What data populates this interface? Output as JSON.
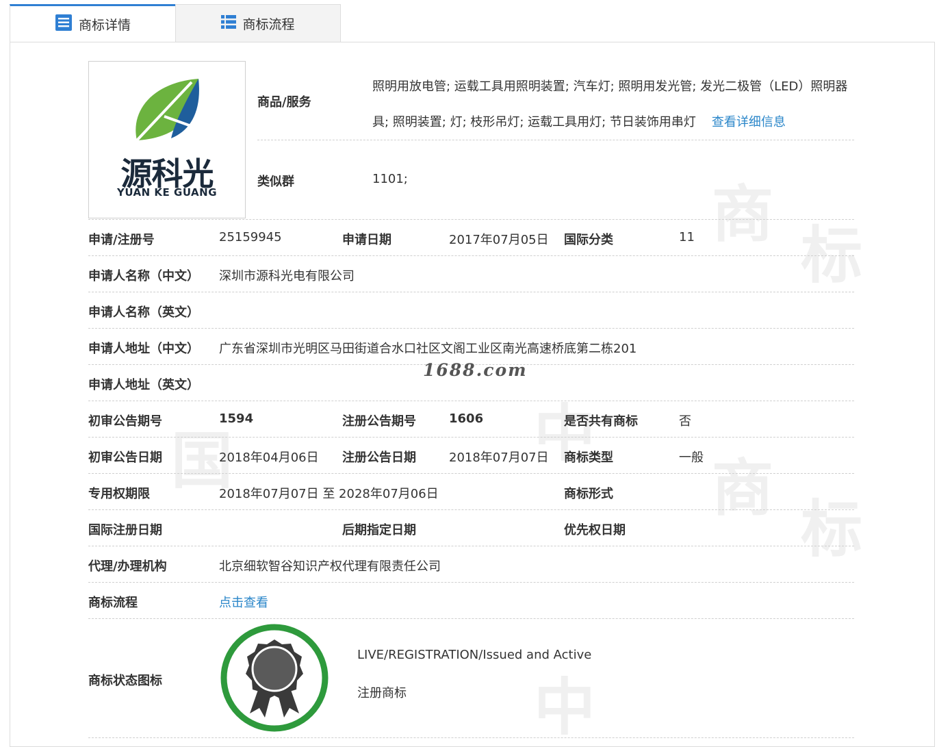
{
  "tabs": [
    {
      "label": "商标详情",
      "icon": "list-doc-icon"
    },
    {
      "label": "商标流程",
      "icon": "flow-list-icon"
    }
  ],
  "logo": {
    "cn": "源科光",
    "en": "YUAN KE GUANG"
  },
  "goods": {
    "label": "商品/服务",
    "text": "照明用放电管; 运载工具用照明装置; 汽车灯; 照明用发光管; 发光二极管（LED）照明器具; 照明装置; 灯; 枝形吊灯; 运载工具用灯; 节日装饰用串灯",
    "link": "查看详细信息"
  },
  "similar_group": {
    "label": "类似群",
    "value": "1101;"
  },
  "fields": {
    "reg_no_label": "申请/注册号",
    "reg_no": "25159945",
    "apply_date_label": "申请日期",
    "apply_date": "2017年07月05日",
    "intl_class_label": "国际分类",
    "intl_class": "11",
    "applicant_cn_label": "申请人名称（中文）",
    "applicant_cn": "深圳市源科光电有限公司",
    "applicant_en_label": "申请人名称（英文）",
    "applicant_en": "",
    "address_cn_label": "申请人地址（中文）",
    "address_cn": "广东省深圳市光明区马田街道合水口社区文阁工业区南光高速桥底第二栋201",
    "address_en_label": "申请人地址（英文）",
    "address_en": "",
    "prelim_no_label": "初审公告期号",
    "prelim_no": "1594",
    "reg_notice_no_label": "注册公告期号",
    "reg_notice_no": "1606",
    "shared_label": "是否共有商标",
    "shared": "否",
    "prelim_date_label": "初审公告日期",
    "prelim_date": "2018年04月06日",
    "reg_notice_date_label": "注册公告日期",
    "reg_notice_date": "2018年07月07日",
    "tm_type_label": "商标类型",
    "tm_type": "一般",
    "exclusive_label": "专用权期限",
    "exclusive": "2018年07月07日 至 2028年07月06日",
    "tm_form_label": "商标形式",
    "tm_form": "",
    "intl_reg_date_label": "国际注册日期",
    "intl_reg_date": "",
    "later_date_label": "后期指定日期",
    "later_date": "",
    "priority_label": "优先权日期",
    "priority": "",
    "agent_label": "代理/办理机构",
    "agent": "北京细软智谷知识产权代理有限责任公司",
    "flow_label": "商标流程",
    "flow_link": "点击查看",
    "status_label": "商标状态图标",
    "status_en": "LIVE/REGISTRATION/Issued and Active",
    "status_cn": "注册商标"
  },
  "watermark_site": "1688.com",
  "colors": {
    "accent": "#2f7fd3",
    "link": "#2a86c9",
    "status_ring": "#2e9a3c"
  }
}
